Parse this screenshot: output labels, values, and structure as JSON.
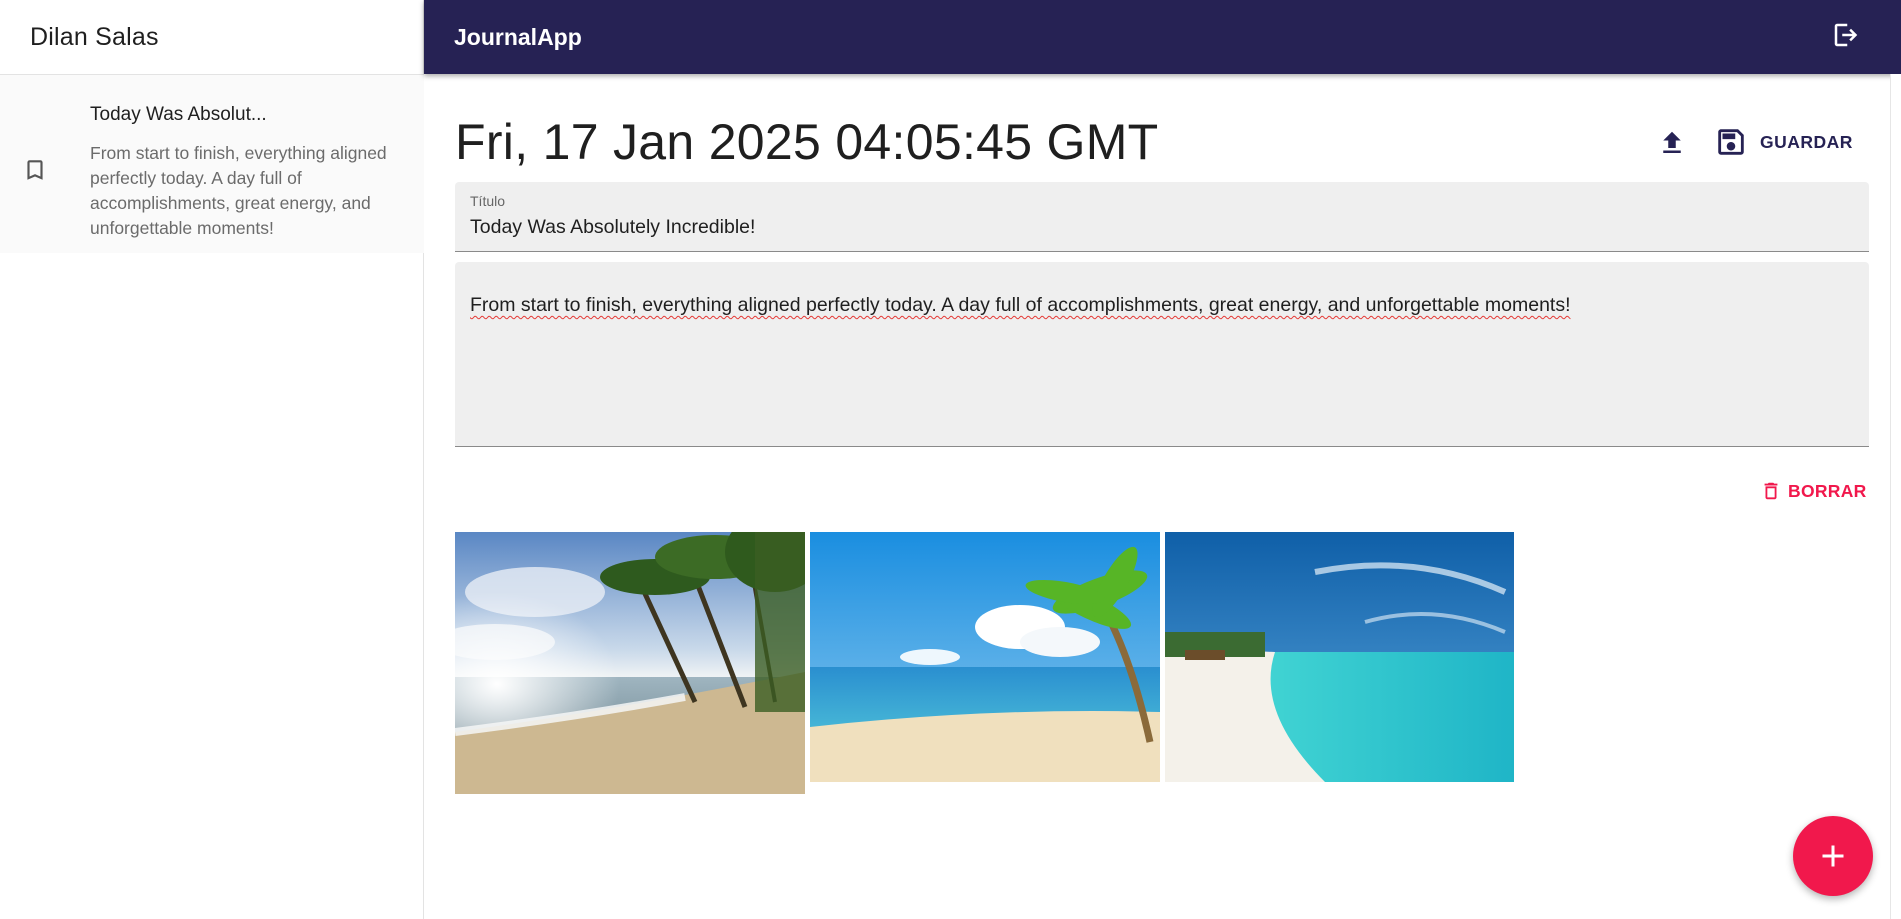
{
  "sidebar": {
    "user_name": "Dilan Salas",
    "entries": [
      {
        "title": "Today Was Absolut...",
        "body": "From start to finish, everything aligned perfectly today. A day full of accomplishments, great energy, and unforgettable moments!",
        "icon": "bookmark-icon"
      }
    ]
  },
  "topbar": {
    "app_title": "JournalApp",
    "logout_icon": "logout-icon"
  },
  "note": {
    "date": "Fri, 17 Jan 2025 04:05:45 GMT",
    "upload_icon": "upload-icon",
    "save_label": "GUARDAR",
    "title_label": "Título",
    "title_value": "Today Was Absolutely Incredible!",
    "body_value": "From start to finish, everything aligned perfectly today. A day full of accomplishments, great energy, and unforgettable moments!",
    "delete_label": "BORRAR"
  },
  "gallery": {
    "images": [
      {
        "name": "beach-palms-sunset-image"
      },
      {
        "name": "beach-palm-tree-image"
      },
      {
        "name": "turquoise-beach-image"
      }
    ]
  },
  "fab": {
    "icon": "plus-icon"
  },
  "colors": {
    "primary": "#262254",
    "accent": "#f1184c",
    "field_bg": "#efefef"
  }
}
